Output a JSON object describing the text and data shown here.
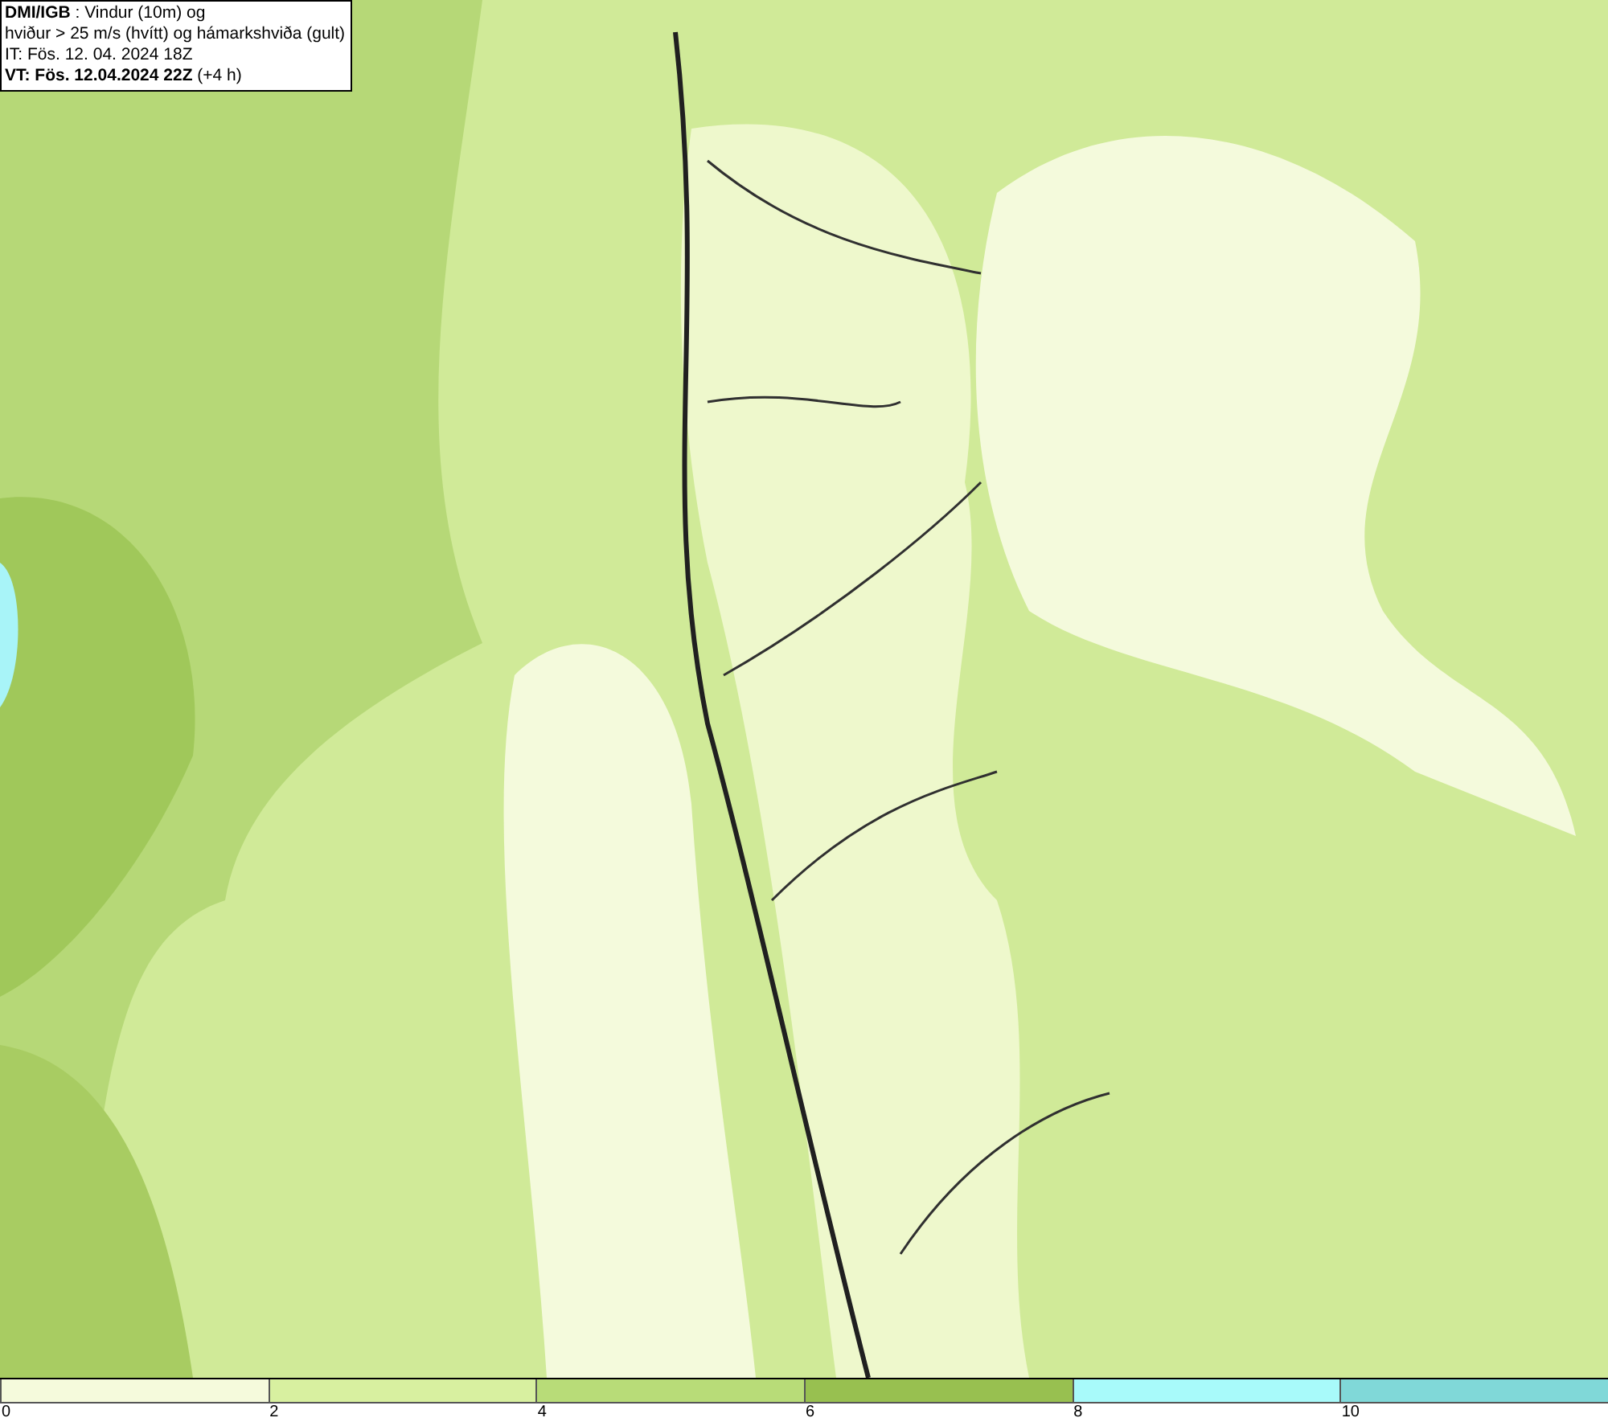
{
  "info_box": {
    "lines": [
      "**DMI/IGB** : Vindur (10m) og",
      "hviður > 25 m/s (hvítt) og hámarkshviða (gult)",
      "IT: Fös. 12. 04. 2024 18Z",
      "**VT: Fös. 12.04.2024 22Z** (+4 h)"
    ]
  },
  "legend": {
    "bins": [
      {
        "color": "#f5fadc",
        "label": "0"
      },
      {
        "color": "#d8f0a0",
        "label": "2"
      },
      {
        "color": "#b8dc78",
        "label": "4"
      },
      {
        "color": "#98c050",
        "label": "6"
      },
      {
        "color": "#a8fafa",
        "label": "8"
      },
      {
        "color": "#80d8d8",
        "label": "10"
      }
    ]
  }
}
